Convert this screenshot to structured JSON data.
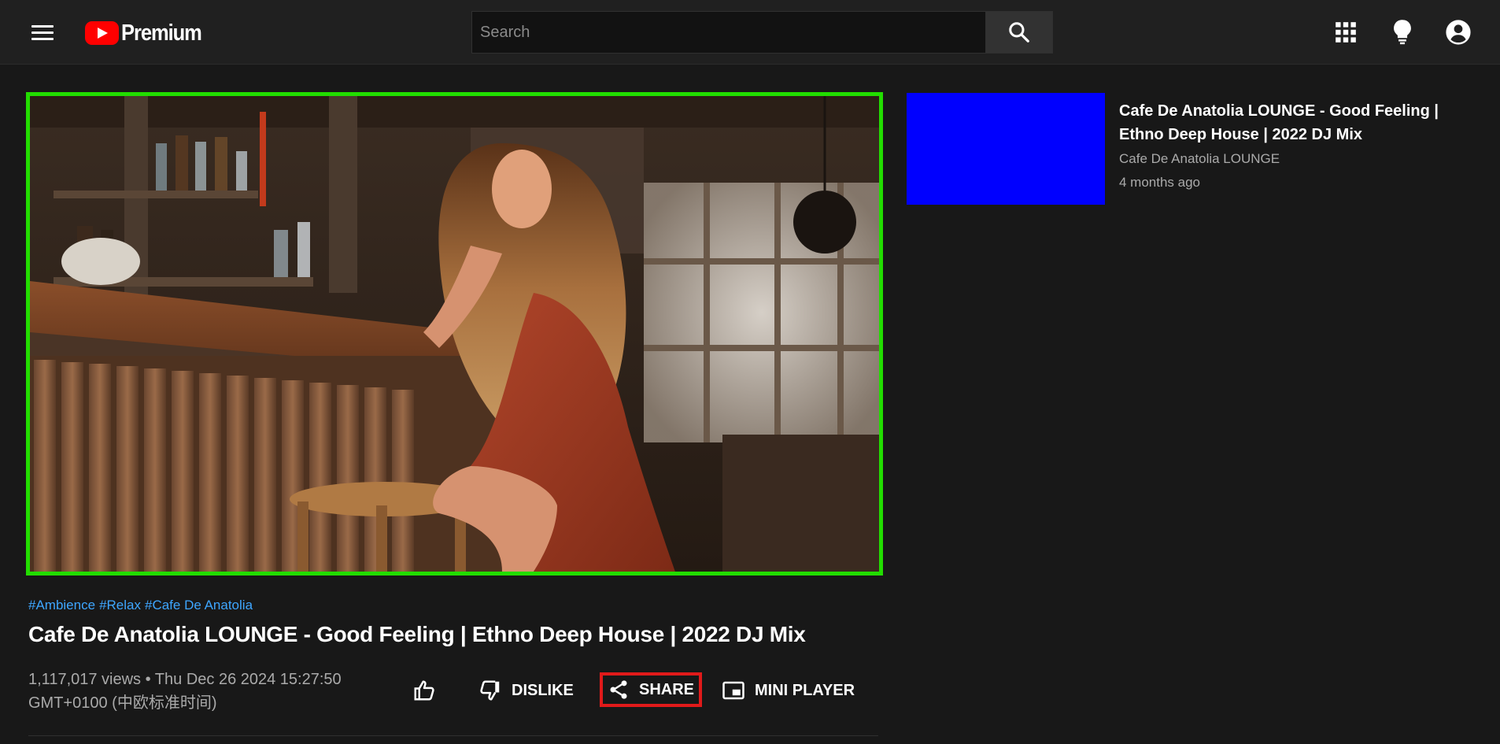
{
  "header": {
    "logo_text": "Premium",
    "search_placeholder": "Search",
    "icons": [
      "menu-icon",
      "youtube-logo-icon",
      "search-icon",
      "apps-grid-icon",
      "lightbulb-icon",
      "account-circle-icon"
    ]
  },
  "video": {
    "hashtags": [
      "#Ambience",
      "#Relax",
      "#Cafe De Anatolia"
    ],
    "title": "Cafe De Anatolia LOUNGE - Good Feeling | Ethno Deep House | 2022 DJ Mix",
    "meta_line1": "1,117,017 views • Thu Dec 26 2024 15:27:50",
    "meta_line2": "GMT+0100 (中欧标准时间)",
    "actions": {
      "dislike_label": "DISLIKE",
      "share_label": "SHARE",
      "mini_player_label": "MINI PLAYER"
    }
  },
  "recommended": [
    {
      "title": "Cafe De Anatolia LOUNGE - Good Feeling | Ethno Deep House | 2022 DJ Mix",
      "channel": "Cafe De Anatolia LOUNGE",
      "age": "4 months ago",
      "thumbnail_color": "#0000ff"
    }
  ],
  "colors": {
    "background": "#181818",
    "header": "#202020",
    "player_border": "#22dd00",
    "share_highlight": "#e11a1a",
    "hashtag": "#3ea6ff",
    "brand_red": "#ff0000"
  }
}
